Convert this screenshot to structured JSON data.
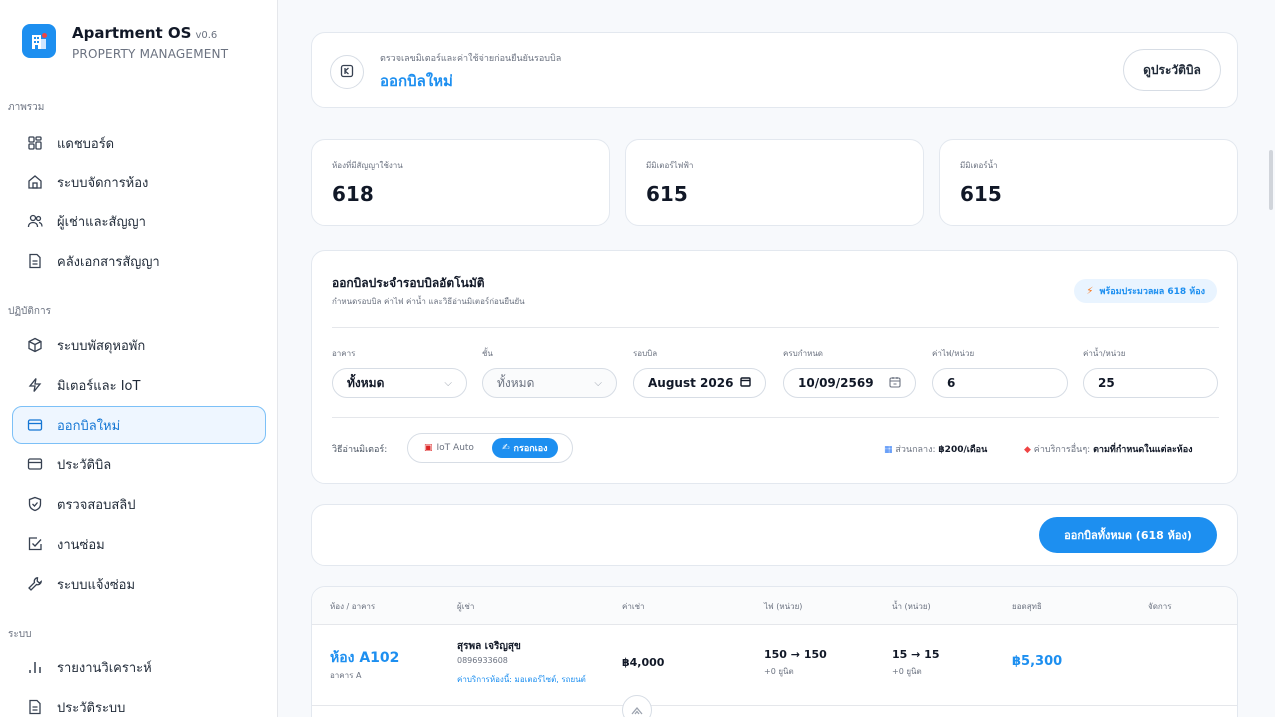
{
  "brand": {
    "title": "Apartment OS",
    "version": "v0.6",
    "subtitle": "PROPERTY MANAGEMENT"
  },
  "sidebar": {
    "sections": [
      {
        "label": "ภาพรวม"
      },
      {
        "label": "ปฏิบัติการ"
      },
      {
        "label": "ระบบ"
      }
    ],
    "items": [
      {
        "label": "แดชบอร์ด",
        "icon": "dashboard-icon"
      },
      {
        "label": "ระบบจัดการห้อง",
        "icon": "home-icon"
      },
      {
        "label": "ผู้เช่าและสัญญา",
        "icon": "users-icon"
      },
      {
        "label": "คลังเอกสารสัญญา",
        "icon": "document-icon"
      },
      {
        "label": "ระบบพัสดุหอพัก",
        "icon": "package-icon"
      },
      {
        "label": "มิเตอร์และ IoT",
        "icon": "bolt-icon"
      },
      {
        "label": "ออกบิลใหม่",
        "icon": "card-icon",
        "active": true
      },
      {
        "label": "ประวัติบิล",
        "icon": "card-icon"
      },
      {
        "label": "ตรวจสอบสลิป",
        "icon": "shield-icon"
      },
      {
        "label": "งานซ่อม",
        "icon": "checkbox-icon"
      },
      {
        "label": "ระบบแจ้งซ่อม",
        "icon": "wrench-icon"
      },
      {
        "label": "รายงานวิเคราะห์",
        "icon": "chart-icon"
      },
      {
        "label": "ประวัติระบบ",
        "icon": "document-icon"
      }
    ]
  },
  "header": {
    "subtitle": "ตรวจเลขมิเตอร์และค่าใช้จ่ายก่อนยืนยันรอบบิล",
    "title": "ออกบิลใหม่",
    "history_button": "ดูประวัติบิล"
  },
  "stats": [
    {
      "label": "ห้องที่มีสัญญาใช้งาน",
      "value": "618"
    },
    {
      "label": "มีมิเตอร์ไฟฟ้า",
      "value": "615"
    },
    {
      "label": "มีมิเตอร์น้ำ",
      "value": "615"
    }
  ],
  "billing": {
    "title": "ออกบิลประจำรอบบิลอัตโนมัติ",
    "subtitle": "กำหนดรอบบิล ค่าไฟ ค่าน้ำ และวิธีอ่านมิเตอร์ก่อนยืนยัน",
    "ready_badge": "พร้อมประมวลผล 618 ห้อง",
    "fields": {
      "building_label": "อาคาร",
      "building_value": "ทั้งหมด",
      "floor_label": "ชั้น",
      "floor_value": "ทั้งหมด",
      "cycle_label": "รอบบิล",
      "cycle_value": "August 2026",
      "due_label": "ครบกำหนด",
      "due_value": "10/09/2569",
      "elec_label": "ค่าไฟ/หน่วย",
      "elec_value": "6",
      "water_label": "ค่าน้ำ/หน่วย",
      "water_value": "25"
    },
    "meter_mode_label": "วิธีอ่านมิเตอร์:",
    "mode_iot": "IoT Auto",
    "mode_manual": "กรอกเอง",
    "common_fee_label": "ส่วนกลาง:",
    "common_fee_value": "฿200/เดือน",
    "other_fee_label": "ค่าบริการอื่นๆ:",
    "other_fee_value": "ตามที่กำหนดในแต่ละห้อง"
  },
  "actions": {
    "issue_all": "ออกบิลทั้งหมด (618 ห้อง)"
  },
  "table": {
    "headers": [
      "ห้อง / อาคาร",
      "ผู้เช่า",
      "ค่าเช่า",
      "ไฟ (หน่วย)",
      "น้ำ (หน่วย)",
      "ยอดสุทธิ",
      "จัดการ"
    ],
    "rows": [
      {
        "room": "ห้อง A102",
        "building": "อาคาร A",
        "tenant": "สุรพล เจริญสุข",
        "phone": "0896933608",
        "service": "ค่าบริการห้องนี้: มอเตอร์ไซต์, รถยนต์",
        "rent": "฿4,000",
        "elec": "150 → 150",
        "elec_delta": "+0 ยูนิต",
        "water": "15 → 15",
        "water_delta": "+0 ยูนิต",
        "net": "฿5,300"
      }
    ]
  },
  "colors": {
    "accent": "#1d8ff0",
    "active_bg": "#eef6ff"
  }
}
